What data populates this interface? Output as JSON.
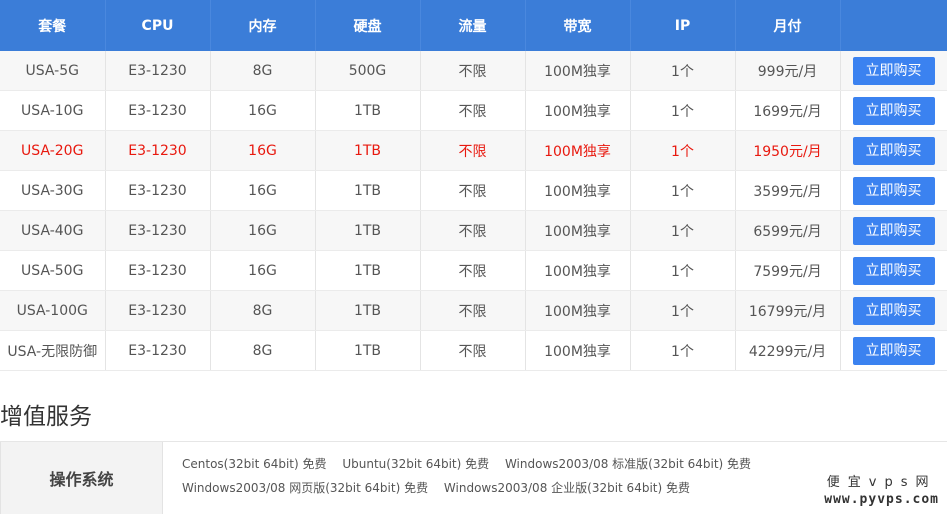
{
  "table": {
    "headers": [
      "套餐",
      "CPU",
      "内存",
      "硬盘",
      "流量",
      "带宽",
      "IP",
      "月付",
      ""
    ],
    "buy_label": "立即购买",
    "rows": [
      {
        "plan": "USA-5G",
        "cpu": "E3-1230",
        "ram": "8G",
        "disk": "500G",
        "traffic": "不限",
        "bandwidth": "100M独享",
        "ip": "1个",
        "price": "999元/月"
      },
      {
        "plan": "USA-10G",
        "cpu": "E3-1230",
        "ram": "16G",
        "disk": "1TB",
        "traffic": "不限",
        "bandwidth": "100M独享",
        "ip": "1个",
        "price": "1699元/月"
      },
      {
        "plan": "USA-20G",
        "cpu": "E3-1230",
        "ram": "16G",
        "disk": "1TB",
        "traffic": "不限",
        "bandwidth": "100M独享",
        "ip": "1个",
        "price": "1950元/月"
      },
      {
        "plan": "USA-30G",
        "cpu": "E3-1230",
        "ram": "16G",
        "disk": "1TB",
        "traffic": "不限",
        "bandwidth": "100M独享",
        "ip": "1个",
        "price": "3599元/月"
      },
      {
        "plan": "USA-40G",
        "cpu": "E3-1230",
        "ram": "16G",
        "disk": "1TB",
        "traffic": "不限",
        "bandwidth": "100M独享",
        "ip": "1个",
        "price": "6599元/月"
      },
      {
        "plan": "USA-50G",
        "cpu": "E3-1230",
        "ram": "16G",
        "disk": "1TB",
        "traffic": "不限",
        "bandwidth": "100M独享",
        "ip": "1个",
        "price": "7599元/月"
      },
      {
        "plan": "USA-100G",
        "cpu": "E3-1230",
        "ram": "8G",
        "disk": "1TB",
        "traffic": "不限",
        "bandwidth": "100M独享",
        "ip": "1个",
        "price": "16799元/月"
      },
      {
        "plan": "USA-无限防御",
        "cpu": "E3-1230",
        "ram": "8G",
        "disk": "1TB",
        "traffic": "不限",
        "bandwidth": "100M独享",
        "ip": "1个",
        "price": "42299元/月"
      }
    ]
  },
  "colors": {
    "header_bg": "#3b7dd8",
    "button_bg": "#3b82f0",
    "highlight_text": "#e8190f"
  },
  "highlight_row": 2,
  "value_added": {
    "title": "增值服务",
    "os_label": "操作系统",
    "os_line1": [
      "Centos(32bit 64bit) 免费",
      "Ubuntu(32bit 64bit) 免费",
      "Windows2003/08 标准版(32bit 64bit) 免费"
    ],
    "os_line2": [
      "Windows2003/08 网页版(32bit 64bit) 免费",
      "Windows2003/08 企业版(32bit 64bit) 免费"
    ]
  },
  "watermark": {
    "line1": "便宜vps网",
    "line2": "www.pyvps.com"
  }
}
